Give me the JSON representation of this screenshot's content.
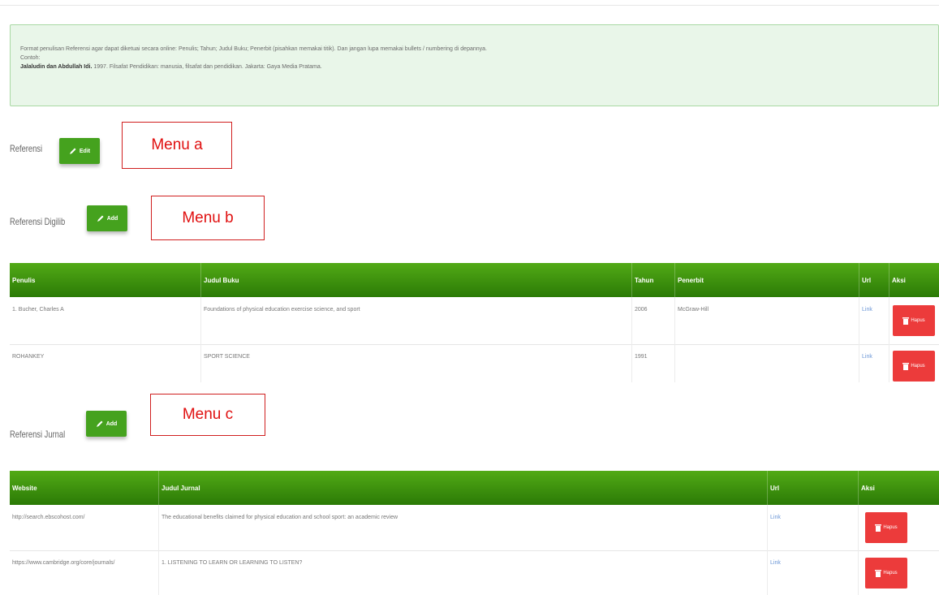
{
  "info": {
    "line1": "Format penulisan Referensi agar dapat diketuai secara online: Penulis; Tahun; Judul Buku; Penerbit (pisahkan memakai titik). Dan jangan lupa memakai bullets / numbering di depannya.",
    "line2": "Contoh:",
    "example_bold": "Jalaludin dan Abdullah Idi.",
    "example_rest": " 1997. Filsafat Pendidikan: manusia, filsafat dan pendidikan. Jakarta: Gaya Media Pratama."
  },
  "referensi": {
    "label": "Referensi",
    "button": "Edit",
    "annotation": "Menu a"
  },
  "digilib": {
    "label": "Referensi Digilib",
    "button": "Add",
    "annotation": "Menu b",
    "columns": [
      "Penulis",
      "Judul Buku",
      "Tahun",
      "Penerbit",
      "Url",
      "Aksi"
    ],
    "rows": [
      {
        "penulis": "1. Bucher, Charles A",
        "judul": "Foundations of physical education exercise science, and sport",
        "tahun": "2006",
        "penerbit": "McGraw-Hill",
        "url": "Link",
        "aksi": "Hapus"
      },
      {
        "penulis": "ROHANKEY",
        "judul": "SPORT SCIENCE",
        "tahun": "1991",
        "penerbit": "",
        "url": "Link",
        "aksi": "Hapus"
      }
    ]
  },
  "jurnal": {
    "label": "Referensi Jurnal",
    "button": "Add",
    "annotation": "Menu c",
    "columns": [
      "Website",
      "Judul Jurnal",
      "Url",
      "Aksi"
    ],
    "rows": [
      {
        "website": "http://search.ebscohost.com/",
        "judul": "The educational benefits claimed for physical education and school sport: an academic review",
        "url": "Link",
        "aksi": "Hapus"
      },
      {
        "website": "https://www.cambridge.org/core/journals/",
        "judul": "1. LISTENING TO LEARN OR LEARNING TO LISTEN?",
        "url": "Link",
        "aksi": "Hapus"
      }
    ]
  },
  "colors": {
    "green": "#45a21e",
    "header_green": "#3e9412",
    "red": "#ec3b3b",
    "annotation_red": "#e01010"
  }
}
